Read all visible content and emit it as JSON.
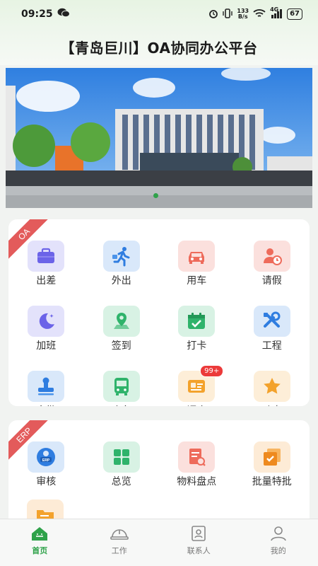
{
  "status_bar": {
    "time": "09:25",
    "net_speed_top": "133",
    "net_speed_unit": "B/s",
    "network": "4G",
    "battery": "67"
  },
  "header": {
    "title": "【青岛巨川】OA协同办公平台"
  },
  "oa": {
    "ribbon": "OA",
    "items": [
      {
        "label": "出差",
        "icon": "briefcase-icon"
      },
      {
        "label": "外出",
        "icon": "running-icon"
      },
      {
        "label": "用车",
        "icon": "car-icon"
      },
      {
        "label": "请假",
        "icon": "user-clock-icon"
      },
      {
        "label": "加班",
        "icon": "moon-icon"
      },
      {
        "label": "签到",
        "icon": "map-pin-icon"
      },
      {
        "label": "打卡",
        "icon": "calendar-check-icon"
      },
      {
        "label": "工程",
        "icon": "tools-icon"
      },
      {
        "label": "审批",
        "icon": "stamp-icon"
      },
      {
        "label": "班车",
        "icon": "bus-icon"
      },
      {
        "label": "调度",
        "icon": "id-card-icon",
        "badge": "99+"
      },
      {
        "label": "动态",
        "icon": "star-icon"
      }
    ]
  },
  "erp": {
    "ribbon": "ERP",
    "items": [
      {
        "label": "审核",
        "icon": "erp-user-icon"
      },
      {
        "label": "总览",
        "icon": "grid-icon"
      },
      {
        "label": "物料盘点",
        "icon": "inventory-icon"
      },
      {
        "label": "批量特批",
        "icon": "batch-approve-icon"
      }
    ]
  },
  "nav": {
    "items": [
      {
        "label": "首页",
        "active": true
      },
      {
        "label": "工作",
        "active": false
      },
      {
        "label": "联系人",
        "active": false
      },
      {
        "label": "我的",
        "active": false
      }
    ]
  },
  "colors": {
    "accent": "#2fa24a",
    "ribbon": "#e35b5b",
    "badge": "#ec3a3a"
  }
}
